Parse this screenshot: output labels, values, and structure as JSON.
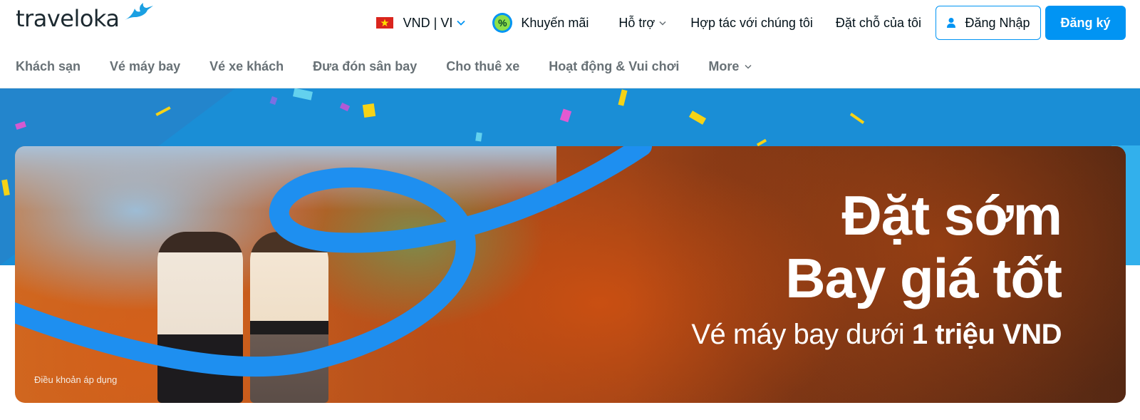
{
  "header": {
    "logo_text": "traveloka",
    "currency": "VND | VI",
    "promo_label": "Khuyến mãi",
    "support_label": "Hỗ trợ",
    "partner_label": "Hợp tác với chúng tôi",
    "my_booking_label": "Đặt chỗ của tôi",
    "login_label": "Đăng Nhập",
    "register_label": "Đăng ký",
    "colors": {
      "brand": "#0194f3",
      "text": "#03121a"
    }
  },
  "tabs": [
    {
      "label": "Khách sạn"
    },
    {
      "label": "Vé máy bay"
    },
    {
      "label": "Vé xe khách"
    },
    {
      "label": "Đưa đón sân bay"
    },
    {
      "label": "Cho thuê xe"
    },
    {
      "label": "Hoạt động & Vui chơi"
    },
    {
      "label": "More"
    }
  ],
  "banner": {
    "headline_line1": "Đặt sớm",
    "headline_line2": "Bay giá tốt",
    "subline_prefix": "Vé máy bay dưới ",
    "subline_bold": "1 triệu VND",
    "terms": "Điều khoản áp dụng"
  },
  "icons": [
    "vietnam-flag-icon",
    "chevron-down-icon",
    "percent-icon",
    "user-icon",
    "bird-logo-icon"
  ]
}
